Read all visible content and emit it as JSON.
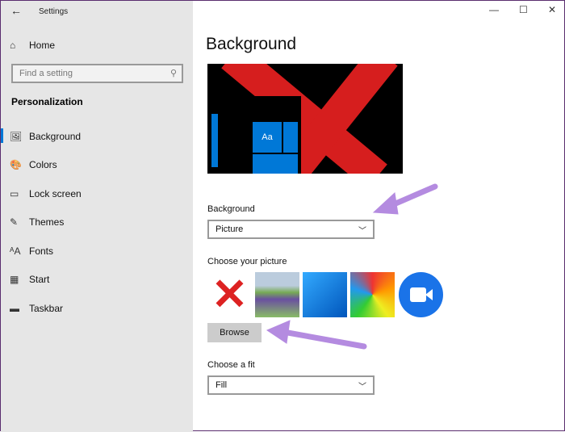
{
  "window": {
    "title": "Settings",
    "back": "←",
    "min": "—",
    "max": "☐",
    "close": "✕"
  },
  "sidebar": {
    "home": "Home",
    "search_placeholder": "Find a setting",
    "section": "Personalization",
    "items": [
      {
        "label": "Background",
        "icon": "🖼"
      },
      {
        "label": "Colors",
        "icon": "🎨"
      },
      {
        "label": "Lock screen",
        "icon": "▭"
      },
      {
        "label": "Themes",
        "icon": "✎"
      },
      {
        "label": "Fonts",
        "icon": "ᴬA"
      },
      {
        "label": "Start",
        "icon": "▦"
      },
      {
        "label": "Taskbar",
        "icon": "▬"
      }
    ]
  },
  "main": {
    "title": "Background",
    "preview_tile": "Aa",
    "background_label": "Background",
    "background_value": "Picture",
    "choose_label": "Choose your picture",
    "browse": "Browse",
    "fit_label": "Choose a fit",
    "fit_value": "Fill"
  },
  "colors": {
    "accent": "#0078d7",
    "arrow": "#b48be0"
  }
}
